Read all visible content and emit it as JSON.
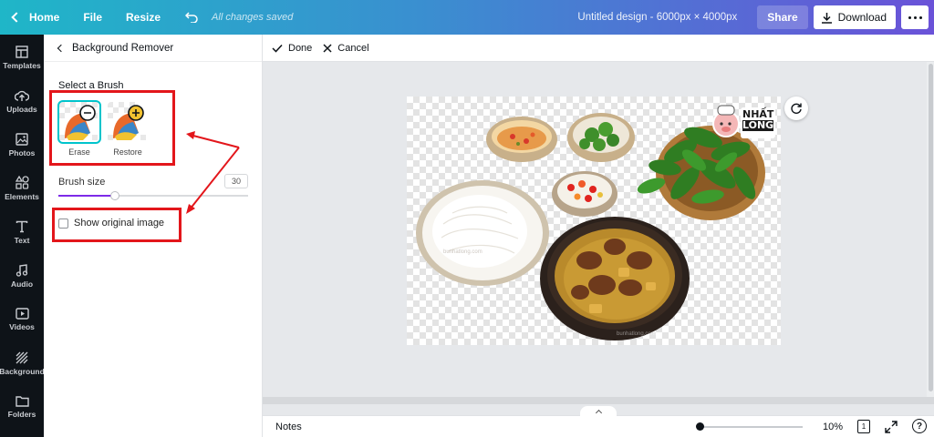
{
  "topbar": {
    "home": "Home",
    "file": "File",
    "resize": "Resize",
    "saved_status": "All changes saved",
    "design_title": "Untitled design - 6000px × 4000px",
    "share": "Share",
    "download": "Download",
    "icons": [
      "chevron-left-icon",
      "undo-icon",
      "download-icon",
      "more-icon"
    ]
  },
  "sidebar": {
    "items": [
      {
        "label": "Templates",
        "icon": "templates-icon"
      },
      {
        "label": "Uploads",
        "icon": "upload-icon"
      },
      {
        "label": "Photos",
        "icon": "photos-icon"
      },
      {
        "label": "Elements",
        "icon": "elements-icon"
      },
      {
        "label": "Text",
        "icon": "text-icon"
      },
      {
        "label": "Audio",
        "icon": "audio-icon"
      },
      {
        "label": "Videos",
        "icon": "video-icon"
      },
      {
        "label": "Background",
        "icon": "background-icon"
      },
      {
        "label": "Folders",
        "icon": "folder-icon"
      }
    ]
  },
  "panel": {
    "title": "Background Remover",
    "select_brush": "Select a Brush",
    "brushes": [
      {
        "label": "Erase",
        "active": true
      },
      {
        "label": "Restore",
        "active": false
      }
    ],
    "brush_size_label": "Brush size",
    "brush_size_value": "30",
    "brush_size_fraction": 0.3,
    "show_original": "Show original image",
    "show_original_checked": false
  },
  "canvas_toolbar": {
    "done": "Done",
    "cancel": "Cancel"
  },
  "canvas": {
    "logo_line1": "NHẤT",
    "logo_line2": "LONG",
    "watermark": "bunhatlong.com"
  },
  "bottombar": {
    "notes": "Notes",
    "zoom": "10%",
    "zoom_fraction": 0.01,
    "page_number": "1",
    "help": "?"
  },
  "colors": {
    "accent": "#00c4cc",
    "purple": "#7d2ae8",
    "annotation_red": "#e3161b"
  }
}
